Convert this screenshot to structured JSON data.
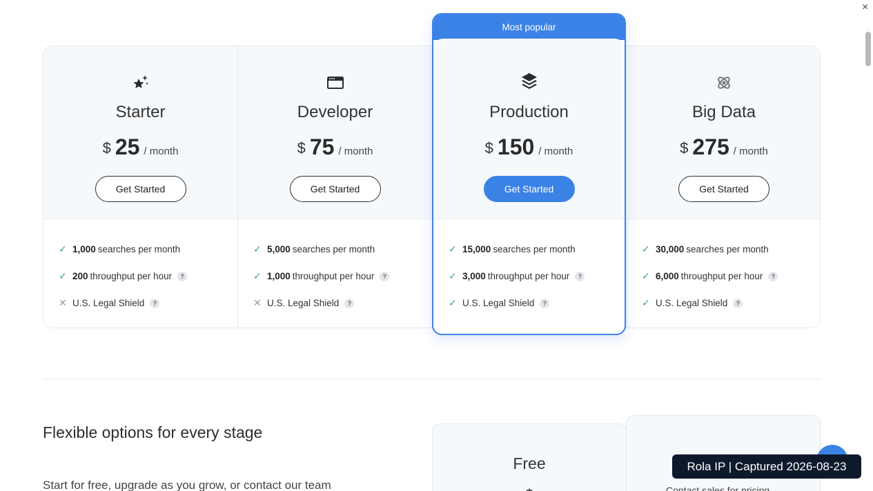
{
  "plans": [
    {
      "name": "Starter",
      "currency": "$",
      "amount": "25",
      "period": "/ month",
      "cta": "Get Started",
      "icon": "sparkle-star-icon",
      "features": [
        {
          "included": true,
          "bold": "1,000",
          "text": "searches per month",
          "help": false
        },
        {
          "included": true,
          "bold": "200",
          "text": "throughput per hour",
          "help": true
        },
        {
          "included": false,
          "bold": "",
          "text": "U.S. Legal Shield",
          "help": true
        }
      ]
    },
    {
      "name": "Developer",
      "currency": "$",
      "amount": "75",
      "period": "/ month",
      "cta": "Get Started",
      "icon": "browser-window-icon",
      "features": [
        {
          "included": true,
          "bold": "5,000",
          "text": "searches per month",
          "help": false
        },
        {
          "included": true,
          "bold": "1,000",
          "text": "throughput per hour",
          "help": true
        },
        {
          "included": false,
          "bold": "",
          "text": "U.S. Legal Shield",
          "help": true
        }
      ]
    },
    {
      "name": "Production",
      "currency": "$",
      "amount": "150",
      "period": "/ month",
      "cta": "Get Started",
      "icon": "layers-icon",
      "banner": "Most popular",
      "features": [
        {
          "included": true,
          "bold": "15,000",
          "text": "searches per month",
          "help": false
        },
        {
          "included": true,
          "bold": "3,000",
          "text": "throughput per hour",
          "help": true
        },
        {
          "included": true,
          "bold": "",
          "text": "U.S. Legal Shield",
          "help": true
        }
      ]
    },
    {
      "name": "Big Data",
      "currency": "$",
      "amount": "275",
      "period": "/ month",
      "cta": "Get Started",
      "icon": "atom-icon",
      "features": [
        {
          "included": true,
          "bold": "30,000",
          "text": "searches per month",
          "help": false
        },
        {
          "included": true,
          "bold": "6,000",
          "text": "throughput per hour",
          "help": true
        },
        {
          "included": true,
          "bold": "",
          "text": "U.S. Legal Shield",
          "help": true
        }
      ]
    }
  ],
  "glyphs": {
    "check": "✓",
    "cross": "✕",
    "help": "?",
    "close": "×"
  },
  "section": {
    "title": "Flexible options for every stage",
    "subtitle": "Start for free, upgrade as you grow, or contact our team"
  },
  "free_card": {
    "title": "Free",
    "price": "$"
  },
  "contact_card": {
    "text": "Contact sales for pricing"
  },
  "badge": {
    "text": "Rola IP | Captured 2026-08-23"
  },
  "colors": {
    "accent": "#3b82e6",
    "check": "#3aa57a",
    "card_bg": "#f6f9fc"
  }
}
